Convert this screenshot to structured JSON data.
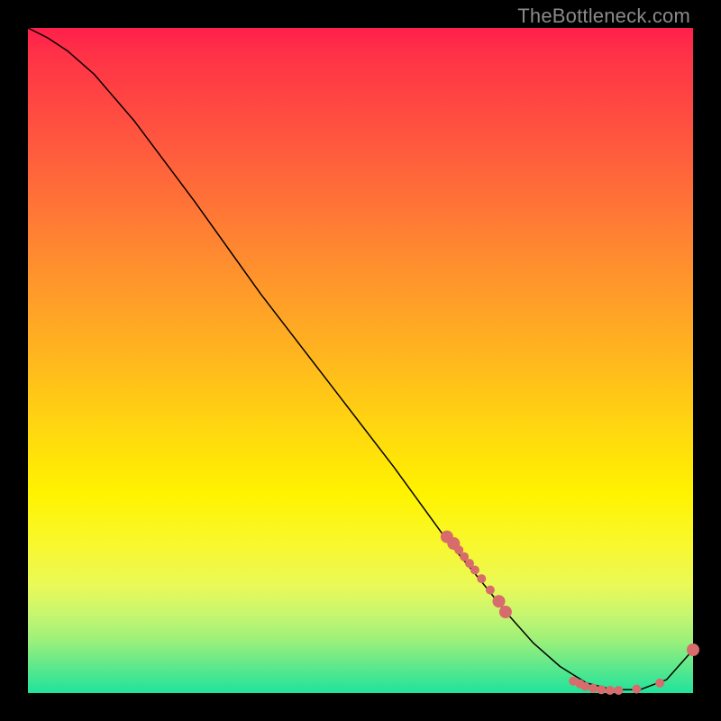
{
  "watermark": "TheBottleneck.com",
  "chart_data": {
    "type": "line",
    "title": "",
    "xlabel": "",
    "ylabel": "",
    "xlim": [
      0,
      1
    ],
    "ylim": [
      0,
      1
    ],
    "grid": false,
    "legend": false,
    "series": [
      {
        "name": "curve",
        "x": [
          0.0,
          0.03,
          0.06,
          0.1,
          0.16,
          0.25,
          0.35,
          0.45,
          0.55,
          0.63,
          0.68,
          0.72,
          0.76,
          0.8,
          0.84,
          0.88,
          0.92,
          0.96,
          1.0
        ],
        "y": [
          1.0,
          0.985,
          0.965,
          0.93,
          0.86,
          0.74,
          0.6,
          0.47,
          0.34,
          0.23,
          0.17,
          0.12,
          0.075,
          0.04,
          0.015,
          0.005,
          0.005,
          0.02,
          0.065
        ]
      }
    ],
    "markers": {
      "color": "#d86b6b",
      "radius_small": 5,
      "radius_large": 7,
      "cluster_a": {
        "comment": "diagonal cluster on descending limb",
        "points": [
          {
            "x": 0.63,
            "y": 0.235
          },
          {
            "x": 0.64,
            "y": 0.225
          },
          {
            "x": 0.648,
            "y": 0.215
          },
          {
            "x": 0.656,
            "y": 0.205
          },
          {
            "x": 0.664,
            "y": 0.195
          },
          {
            "x": 0.672,
            "y": 0.185
          },
          {
            "x": 0.682,
            "y": 0.172
          },
          {
            "x": 0.695,
            "y": 0.155
          },
          {
            "x": 0.708,
            "y": 0.138
          },
          {
            "x": 0.718,
            "y": 0.122
          }
        ]
      },
      "cluster_b": {
        "comment": "valley cluster near minimum",
        "points": [
          {
            "x": 0.82,
            "y": 0.018
          },
          {
            "x": 0.83,
            "y": 0.014
          },
          {
            "x": 0.838,
            "y": 0.01
          },
          {
            "x": 0.85,
            "y": 0.007
          },
          {
            "x": 0.862,
            "y": 0.005
          },
          {
            "x": 0.875,
            "y": 0.004
          },
          {
            "x": 0.888,
            "y": 0.004
          },
          {
            "x": 0.915,
            "y": 0.006
          },
          {
            "x": 0.95,
            "y": 0.015
          }
        ]
      },
      "end_point": {
        "x": 1.0,
        "y": 0.065
      }
    }
  },
  "colors": {
    "background": "#000000",
    "marker": "#d86b6b",
    "curve": "#000000"
  }
}
